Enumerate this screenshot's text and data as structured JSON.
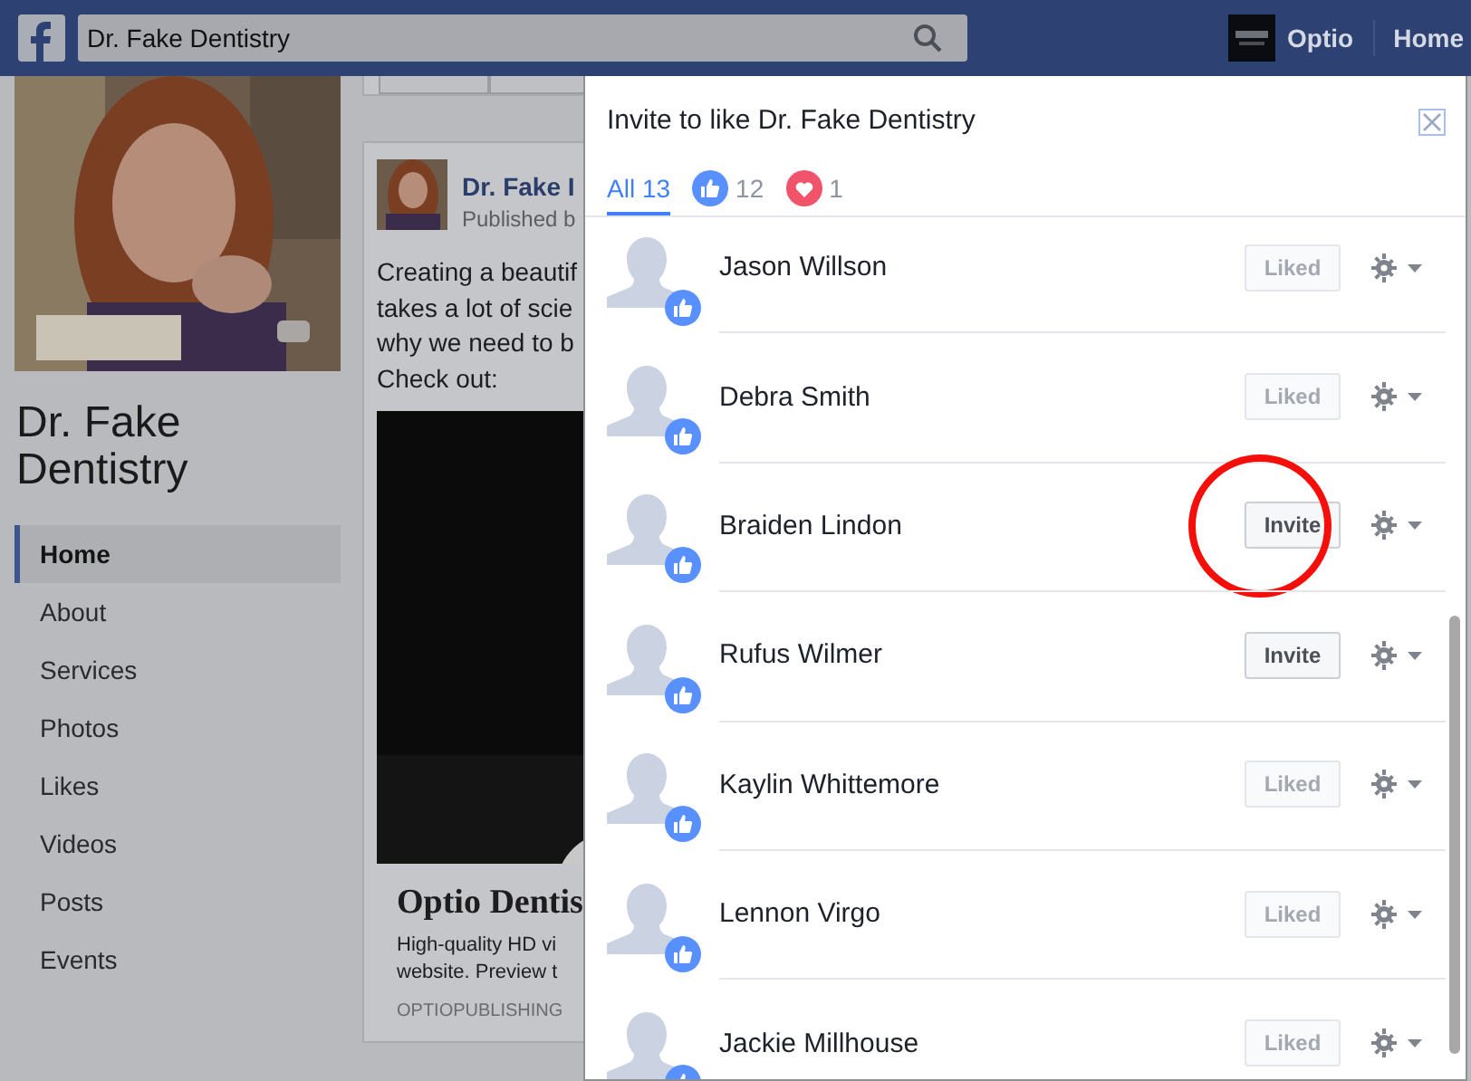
{
  "top_bar": {
    "search": {
      "value": "Dr. Fake Dentistry"
    },
    "account": "Optio",
    "home": "Home"
  },
  "page": {
    "name": "Dr. Fake Dentistry",
    "nav": [
      {
        "label": "Home",
        "selected": true
      },
      {
        "label": "About",
        "selected": false
      },
      {
        "label": "Services",
        "selected": false
      },
      {
        "label": "Photos",
        "selected": false
      },
      {
        "label": "Likes",
        "selected": false
      },
      {
        "label": "Videos",
        "selected": false
      },
      {
        "label": "Posts",
        "selected": false
      },
      {
        "label": "Events",
        "selected": false
      }
    ]
  },
  "post": {
    "author": "Dr. Fake I",
    "meta": "Published b",
    "text": [
      "Creating a beautif",
      "takes a lot of scie",
      "why we need to b",
      "Check out:"
    ],
    "link": {
      "title": "Optio Dentis",
      "description": [
        "High-quality HD vi",
        "website. Preview t"
      ],
      "domain": "OPTIOPUBLISHING"
    }
  },
  "dialog": {
    "title": "Invite to like Dr. Fake Dentistry",
    "tabs": [
      {
        "kind": "all",
        "label": "All 13",
        "selected": true
      },
      {
        "kind": "like",
        "label": "12",
        "selected": false
      },
      {
        "kind": "love",
        "label": "1",
        "selected": false
      }
    ],
    "people": [
      {
        "name": "Jason Willson",
        "liked": true,
        "button": "Liked",
        "circled": false
      },
      {
        "name": "Debra Smith",
        "liked": true,
        "button": "Liked",
        "circled": false
      },
      {
        "name": "Braiden Lindon",
        "liked": false,
        "button": "Invite",
        "circled": true
      },
      {
        "name": "Rufus Wilmer",
        "liked": false,
        "button": "Invite",
        "circled": false
      },
      {
        "name": "Kaylin Whittemore",
        "liked": true,
        "button": "Liked",
        "circled": false
      },
      {
        "name": "Lennon Virgo",
        "liked": true,
        "button": "Liked",
        "circled": false
      },
      {
        "name": "Jackie Millhouse",
        "liked": true,
        "button": "Liked",
        "circled": false
      }
    ]
  }
}
